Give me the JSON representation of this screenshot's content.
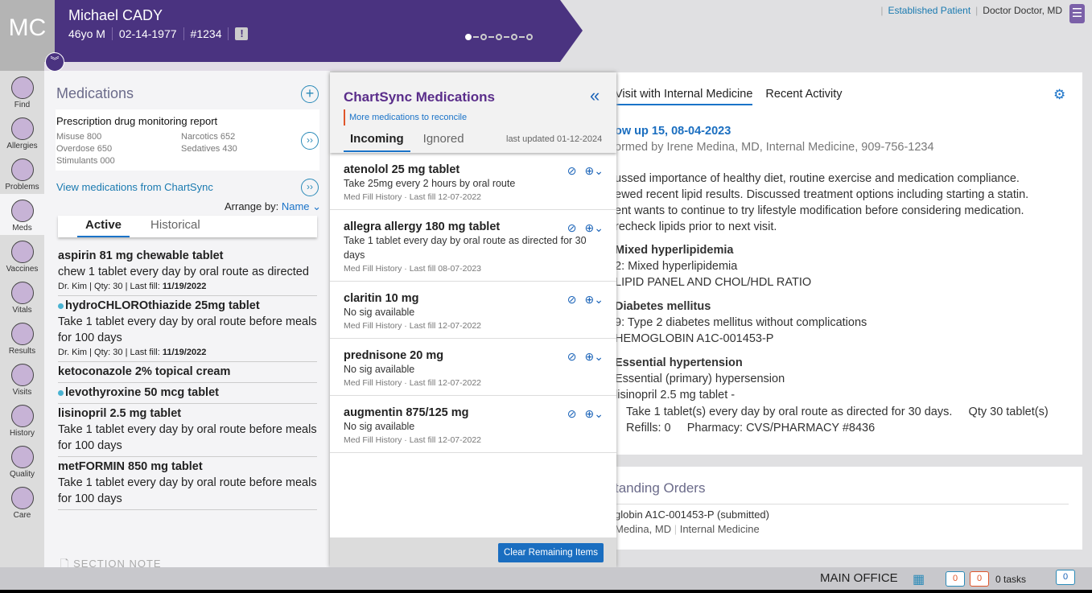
{
  "patient": {
    "initials": "MC",
    "name": "Michael CADY",
    "age_sex": "46yo M",
    "dob": "02-14-1977",
    "id": "#1234",
    "alert_icon": "!"
  },
  "topbar": {
    "patient_status": "Established Patient",
    "provider": "Doctor Doctor, MD"
  },
  "colors": {
    "brand": "#4a3380",
    "accent": "#1a73c8",
    "alert": "#e0562b"
  },
  "sidebar": {
    "items": [
      {
        "label": "Find"
      },
      {
        "label": "Allergies"
      },
      {
        "label": "Problems"
      },
      {
        "label": "Meds",
        "active": true
      },
      {
        "label": "Vaccines"
      },
      {
        "label": "Vitals"
      },
      {
        "label": "Results"
      },
      {
        "label": "Visits"
      },
      {
        "label": "History"
      },
      {
        "label": "Quality"
      },
      {
        "label": "Care"
      }
    ]
  },
  "medications": {
    "title": "Medications",
    "pdmp": {
      "title": "Prescription drug monitoring report",
      "stats": [
        "Misuse 800",
        "Narcotics 652",
        "Overdose 650",
        "Sedatives 430",
        "Stimulants 000"
      ]
    },
    "view_chartsync": "View medications from ChartSync",
    "arrange_label": "Arrange by:",
    "arrange_value": "Name",
    "tabs": [
      "Active",
      "Historical"
    ],
    "items": [
      {
        "name": "aspirin 81 mg chewable tablet",
        "sig": "chew 1 tablet every day by oral route as directed",
        "prescriber": "Dr. Kim",
        "qty_label": "Qty:",
        "qty": "30",
        "fill_label": "Last fill:",
        "fill": "11/19/2022"
      },
      {
        "name": "hydroCHLOROthiazide 25mg tablet",
        "dot": true,
        "sig": "Take 1 tablet every day by oral route before meals for 100 days",
        "prescriber": "Dr. Kim",
        "qty_label": "Qty:",
        "qty": "30",
        "fill_label": "Last fill:",
        "fill": "11/19/2022"
      },
      {
        "name": "ketoconazole 2% topical cream"
      },
      {
        "name": "levothyroxine 50 mcg tablet",
        "dot": true
      },
      {
        "name": "lisinopril 2.5 mg tablet",
        "sig": "Take 1 tablet every day by oral route before meals for 100 days"
      },
      {
        "name": "metFORMIN 850 mg tablet",
        "sig": "Take 1 tablet every day by oral route before meals for 100 days"
      }
    ],
    "section_note": "SECTION NOTE"
  },
  "chartsync": {
    "title": "ChartSync Medications",
    "notice": "More medications to reconcile",
    "tabs": [
      "Incoming",
      "Ignored"
    ],
    "last_updated": "last updated 01-12-2024",
    "items": [
      {
        "name": "atenolol 25 mg tablet",
        "sig": "Take 25mg every 2 hours by oral route",
        "source": "Med Fill History",
        "fill": "Last fill  12-07-2022"
      },
      {
        "name": "allegra allergy 180 mg tablet",
        "sig": "Take 1 tablet every day by oral route as directed for 30 days",
        "source": "Med Fill History",
        "fill": "Last fill  08-07-2023"
      },
      {
        "name": "claritin 10 mg",
        "sig": "No sig available",
        "source": "Med Fill History",
        "fill": "Last fill  12-07-2022"
      },
      {
        "name": "prednisone 20 mg",
        "sig": "No sig available",
        "source": "Med Fill History",
        "fill": "Last fill  12-07-2022"
      },
      {
        "name": "augmentin 875/125 mg",
        "sig": "No sig available",
        "source": "Med Fill History",
        "fill": "Last fill  12-07-2022"
      }
    ],
    "clear_button": "Clear Remaining Items"
  },
  "visit": {
    "tabs": [
      "Visit with Internal Medicine",
      "Recent Activity"
    ],
    "title": "ow up 15, 08-04-2023",
    "performed": "ormed by Irene Medina, MD, Internal Medicine, 909-756-1234",
    "note": [
      "ussed importance of healthy diet, routine exercise and medication compliance.",
      "ewed recent lipid results.  Discussed treatment options including starting a statin.",
      "ent wants to continue to try lifestyle modification before considering medication.",
      "recheck lipids prior to next visit."
    ],
    "problems": [
      {
        "title": "Mixed hyperlipidemia",
        "lines": [
          "2: Mixed hyperlipidemia",
          "LIPID PANEL AND CHOL/HDL RATIO"
        ]
      },
      {
        "title": "Diabetes mellitus",
        "lines": [
          "9: Type 2 diabetes mellitus without complications",
          "HEMOGLOBIN A1C-001453-P"
        ]
      },
      {
        "title": "Essential hypertension",
        "lines": [
          "Essential (primary) hypersension",
          "lisinopril 2.5 mg tablet -"
        ]
      }
    ],
    "rx_line": "Take 1 tablet(s) every day by oral route as directed for 30 days.     Qty 30 tablet(s)",
    "rx_line2": "Refills: 0     Pharmacy: CVS/PHARMACY #8436"
  },
  "orders": {
    "title": "tanding Orders",
    "item": "globin  A1C-001453-P (submitted)",
    "provider": " Medina, MD",
    "dept": "Internal Medicine"
  },
  "status": {
    "office": "MAIN OFFICE",
    "count1": "0",
    "count2": "0",
    "tasks": "0 tasks",
    "messages": "0"
  }
}
